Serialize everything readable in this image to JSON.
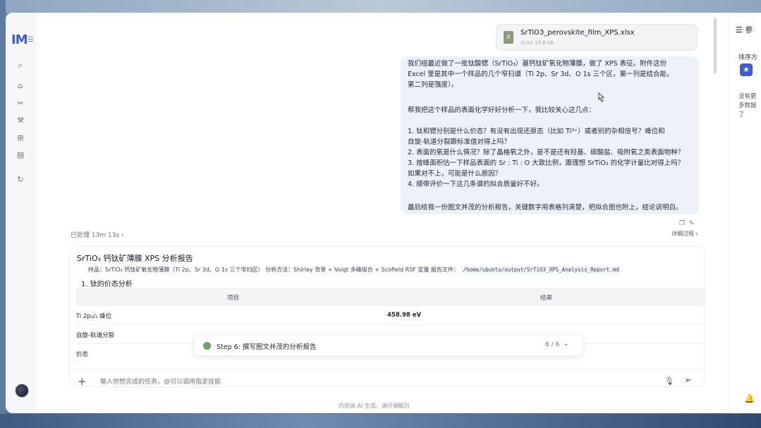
{
  "sidebar": {
    "logo": "IM",
    "icons": [
      "search-icon",
      "home-icon",
      "tools-icon",
      "wrench-icon",
      "grid-icon",
      "layers-icon",
      "history-icon"
    ]
  },
  "file": {
    "name": "SrTiO3_perovskite_film_XPS.xlsx",
    "meta": "XLSX 15.6 kB"
  },
  "message": {
    "lines": [
      "我们组最近做了一批钛酸锶（SrTiO₃）基钙钛矿氧化物薄膜，做了 XPS 表征。附件这份",
      "Excel 里是其中一个样品的几个窄扫谱（Ti 2p、Sr 3d、O 1s 三个区，第一列是结合能，",
      "第二列是强度）。",
      "",
      "帮我把这个样品的表面化学好好分析一下，我比较关心这几点：",
      "",
      "1. 钛和锶分别是什么价态？有没有出现还原态（比如 Ti³⁺）或者别的杂相信号？峰位和",
      "自旋-轨道分裂跟标准值对得上吗？",
      "2. 表面的氧是什么情况？除了晶格氧之外，是不是还有羟基、碳酸盐、吸附氧之类表面物种？",
      "3. 按峰面积估一下样品表面的 Sr : Ti : O 大致比例，跟理想 SrTiO₃ 的化学计量比对得上吗？",
      "如果对不上，可能是什么原因？",
      "4. 顺带评价一下这几条谱的拟合质量好不好。",
      "",
      "最后给我一份图文并茂的分析报告，关键数字用表格列清楚，把拟合图也附上，结论说明白。"
    ]
  },
  "processed": "已处理 13m 13s",
  "detail_link": "详细过程",
  "report": {
    "title": "SrTiO₃ 钙钛矿薄膜 XPS 分析报告",
    "sample_text": "样品：SrTiO₃ 钙钛矿氧化物薄膜（Ti 2p、Sr 3d、O 1s 三个窄扫区） 分析方法：Shirley 背景 + Voigt 多峰拟合 + Scofield RSF 定量 报告文件：",
    "report_path": "/home/ubuntu/output/SrTiO3_XPS_Analysis_Report.md",
    "section": "1. 钛的价态分析",
    "headers": [
      "项目",
      "结果"
    ],
    "rows": [
      {
        "item": "Ti 2p₃/₂ 峰位",
        "result": "458.98 eV"
      },
      {
        "item": "自旋-轨道分裂",
        "result": ""
      },
      {
        "item": "价态",
        "result": ""
      }
    ]
  },
  "step": {
    "label": "Step 6: 撰写图文并茂的分析报告",
    "count": "6 / 6"
  },
  "input": {
    "placeholder": "输入你想完成的任务，@可以调用指定技能"
  },
  "disclaimer": "内容由 AI 生成，请仔细甄别",
  "right_panel": {
    "title": "☰ 参",
    "sort": "排序方",
    "notes": [
      "没有更",
      "多数据",
      "了"
    ]
  }
}
